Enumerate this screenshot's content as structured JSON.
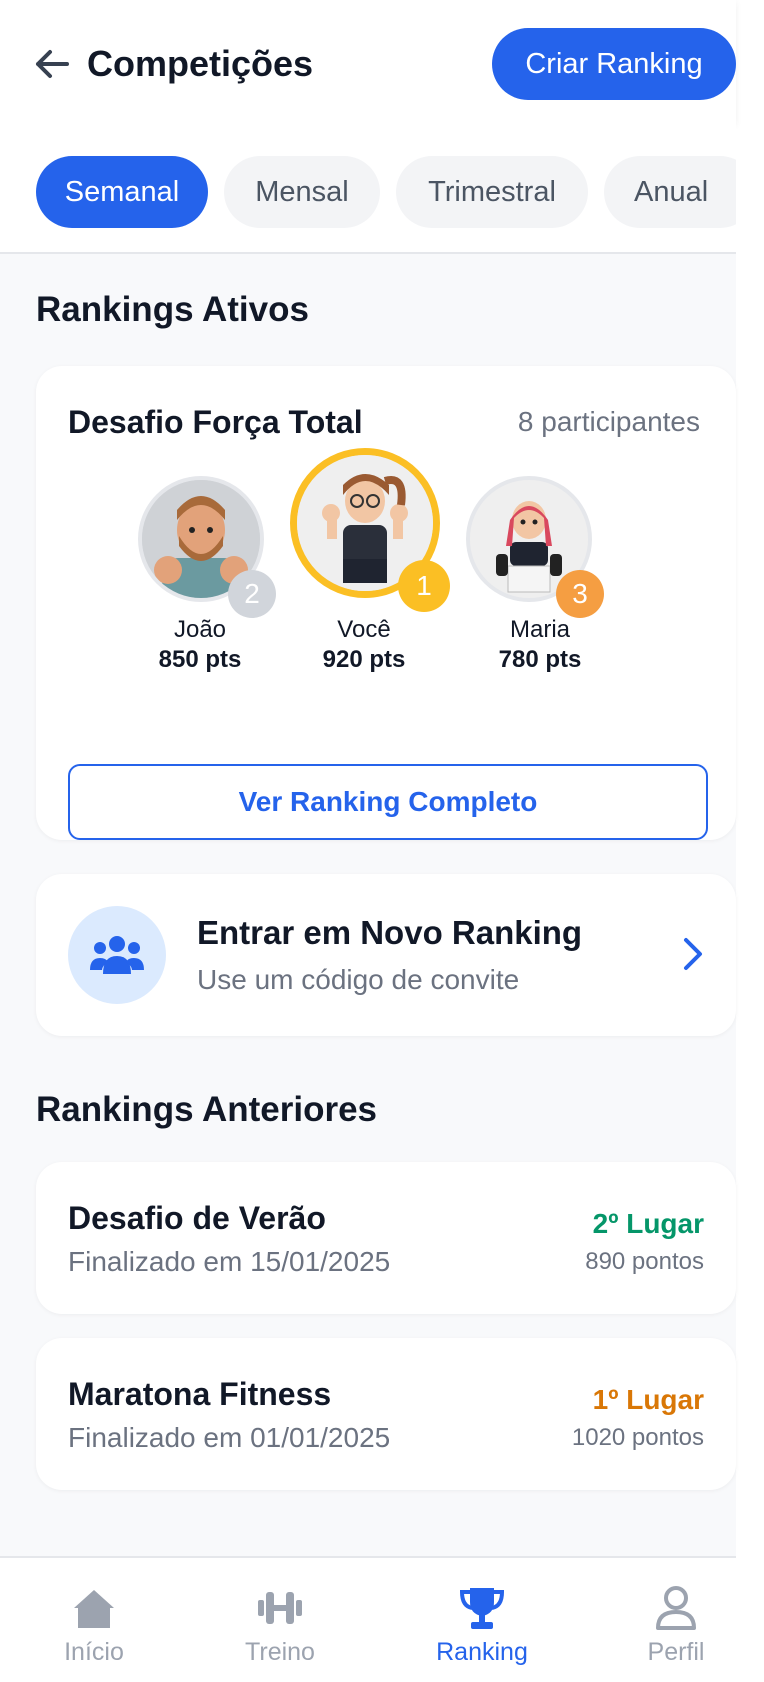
{
  "header": {
    "title": "Competições",
    "create_button": "Criar Ranking"
  },
  "tabs": [
    {
      "label": "Semanal",
      "active": true
    },
    {
      "label": "Mensal",
      "active": false
    },
    {
      "label": "Trimestral",
      "active": false
    },
    {
      "label": "Anual",
      "active": false
    }
  ],
  "active_section": {
    "title": "Rankings Ativos",
    "card": {
      "title": "Desafio Força Total",
      "participants": "8 participantes",
      "podium": [
        {
          "name": "João",
          "points": "850 pts",
          "rank": "2",
          "badge_color": "#d1d5db"
        },
        {
          "name": "Você",
          "points": "920 pts",
          "rank": "1",
          "badge_color": "#fbbf24"
        },
        {
          "name": "Maria",
          "points": "780 pts",
          "rank": "3",
          "badge_color": "#f59e42"
        }
      ],
      "full_ranking_button": "Ver Ranking Completo"
    },
    "join": {
      "title": "Entrar em Novo Ranking",
      "subtitle": "Use um código de convite",
      "icon": "users-icon"
    }
  },
  "past_section": {
    "title": "Rankings Anteriores",
    "items": [
      {
        "title": "Desafio de Verão",
        "date": "Finalizado em 15/01/2025",
        "place": "2º Lugar",
        "place_color": "#059669",
        "points": "890 pontos"
      },
      {
        "title": "Maratona Fitness",
        "date": "Finalizado em 01/01/2025",
        "place": "1º Lugar",
        "place_color": "#d97706",
        "points": "1020 pontos"
      }
    ]
  },
  "bottom_nav": [
    {
      "label": "Início",
      "icon": "home-icon",
      "active": false
    },
    {
      "label": "Treino",
      "icon": "dumbbell-icon",
      "active": false
    },
    {
      "label": "Ranking",
      "icon": "trophy-icon",
      "active": true
    },
    {
      "label": "Perfil",
      "icon": "user-icon",
      "active": false
    }
  ],
  "colors": {
    "primary": "#2563eb",
    "gold": "#fbbf24",
    "silver": "#d1d5db",
    "bronze": "#f59e42"
  }
}
